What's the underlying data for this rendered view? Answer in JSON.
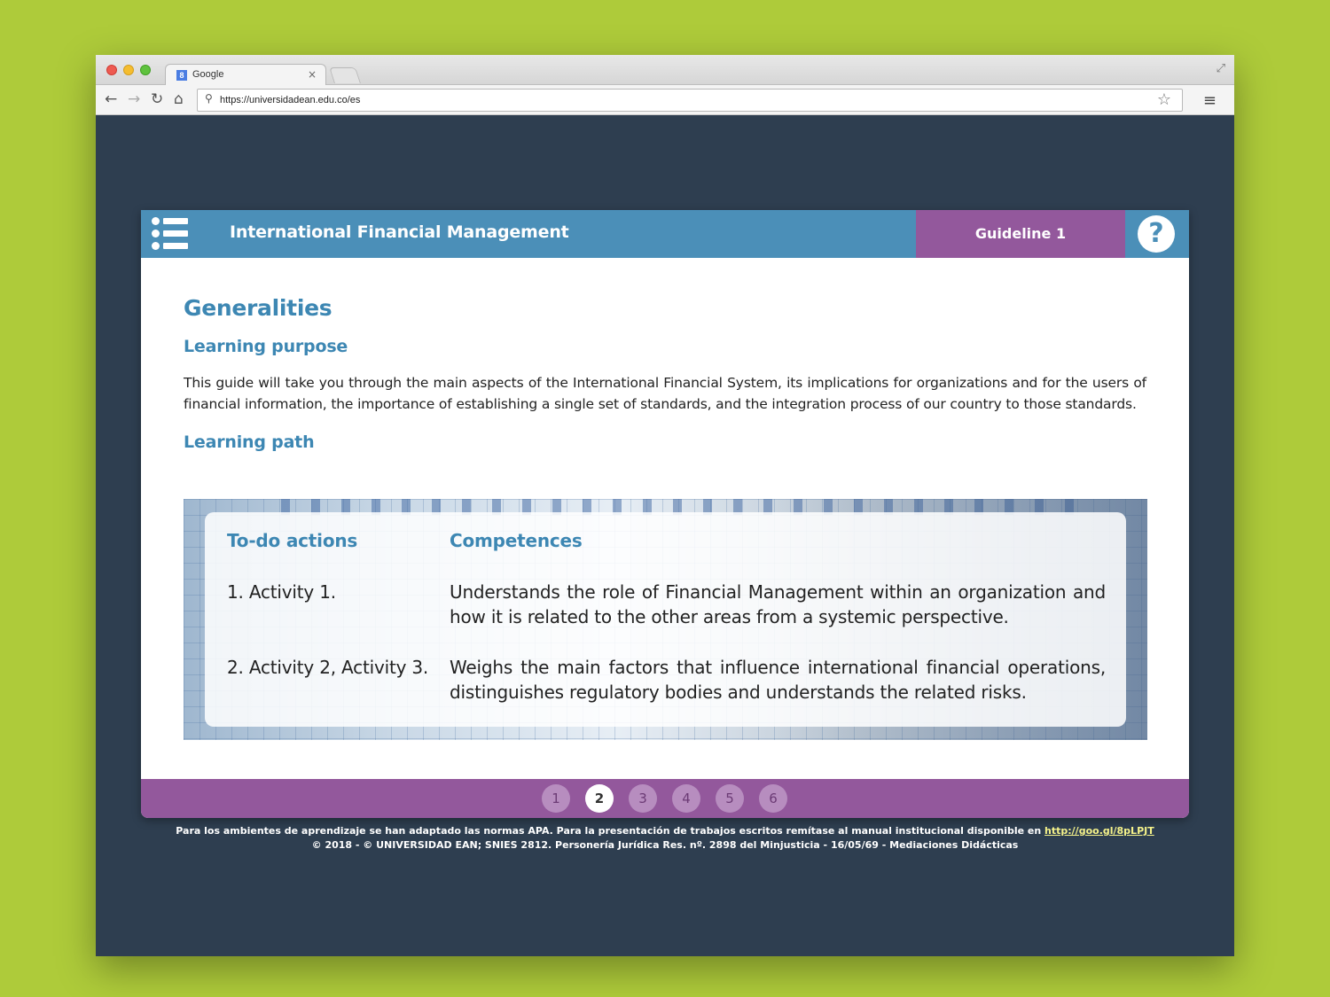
{
  "browser": {
    "tab_title": "Google",
    "tab_close": "×",
    "url": "https://universidadean.edu.co/es",
    "favicon": "8"
  },
  "icons": {
    "back": "arrow-left-icon",
    "forward": "arrow-right-icon",
    "reload": "reload-icon",
    "home": "home-icon",
    "search": "search-icon",
    "star": "star-icon",
    "menu": "hamburger-menu-icon",
    "list": "list-icon",
    "help": "question-icon"
  },
  "header": {
    "course_title": "International Financial Management",
    "guideline": "Guideline 1",
    "help": "?"
  },
  "content": {
    "title": "Generalities",
    "learning_purpose_heading": "Learning purpose",
    "learning_purpose_text": "This guide will take you through the main aspects of the International Financial System, its implications for organizations and for the users of financial information, the importance of establishing a single set of standards, and the integration process of our country to those standards.",
    "learning_path_heading": "Learning path",
    "table": {
      "col1": "To-do actions",
      "col2": "Competences",
      "rows": [
        {
          "action": "1. Activity 1.",
          "competence": "Understands the role of Financial Management within an organization and how it is related to the other areas from a systemic perspective."
        },
        {
          "action": "2. Activity 2, Activity 3.",
          "competence": "Weighs the main factors that influence international financial operations, distinguishes regulatory bodies and understands the related risks."
        }
      ]
    }
  },
  "pagination": {
    "pages": [
      "1",
      "2",
      "3",
      "4",
      "5",
      "6"
    ],
    "current": "2"
  },
  "footer": {
    "line1": "Para los ambientes de aprendizaje se han adaptado las normas APA. Para la presentación de trabajos escritos remítase al manual institucional disponible en",
    "link": "http://goo.gl/8pLPJT",
    "line2": "© 2018 - © UNIVERSIDAD EAN; SNIES 2812. Personería Jurídica Res. nº. 2898 del Minjusticia - 16/05/69 - Mediaciones Didácticas"
  },
  "colors": {
    "background": "#aecb3a",
    "page_bg": "#2e3e50",
    "header_blue": "#4b8fb8",
    "accent_purple": "#93589c",
    "heading_blue": "#3d87b3"
  }
}
